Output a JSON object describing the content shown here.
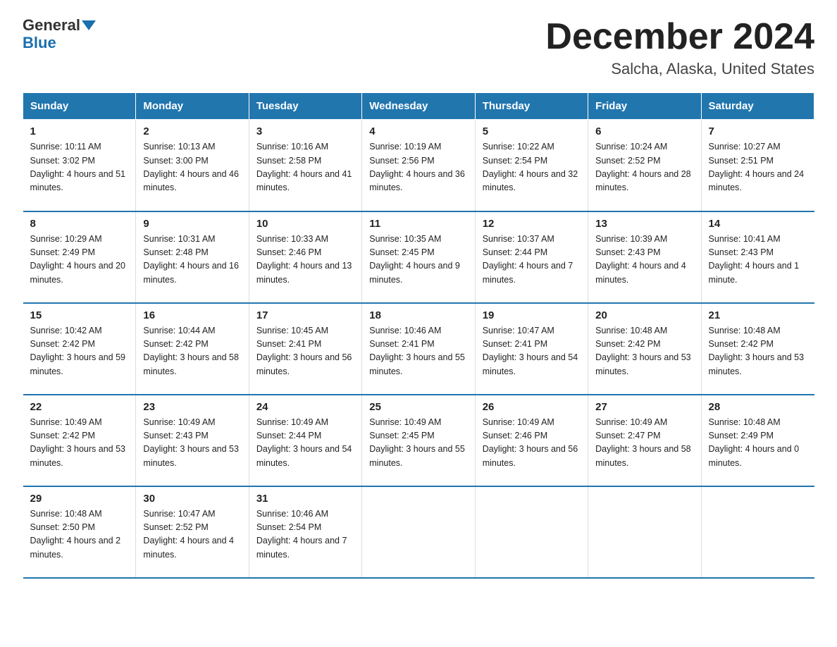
{
  "logo": {
    "general": "General",
    "blue": "Blue"
  },
  "header": {
    "month": "December 2024",
    "location": "Salcha, Alaska, United States"
  },
  "weekdays": [
    "Sunday",
    "Monday",
    "Tuesday",
    "Wednesday",
    "Thursday",
    "Friday",
    "Saturday"
  ],
  "weeks": [
    [
      {
        "day": "1",
        "sunrise": "10:11 AM",
        "sunset": "3:02 PM",
        "daylight": "4 hours and 51 minutes."
      },
      {
        "day": "2",
        "sunrise": "10:13 AM",
        "sunset": "3:00 PM",
        "daylight": "4 hours and 46 minutes."
      },
      {
        "day": "3",
        "sunrise": "10:16 AM",
        "sunset": "2:58 PM",
        "daylight": "4 hours and 41 minutes."
      },
      {
        "day": "4",
        "sunrise": "10:19 AM",
        "sunset": "2:56 PM",
        "daylight": "4 hours and 36 minutes."
      },
      {
        "day": "5",
        "sunrise": "10:22 AM",
        "sunset": "2:54 PM",
        "daylight": "4 hours and 32 minutes."
      },
      {
        "day": "6",
        "sunrise": "10:24 AM",
        "sunset": "2:52 PM",
        "daylight": "4 hours and 28 minutes."
      },
      {
        "day": "7",
        "sunrise": "10:27 AM",
        "sunset": "2:51 PM",
        "daylight": "4 hours and 24 minutes."
      }
    ],
    [
      {
        "day": "8",
        "sunrise": "10:29 AM",
        "sunset": "2:49 PM",
        "daylight": "4 hours and 20 minutes."
      },
      {
        "day": "9",
        "sunrise": "10:31 AM",
        "sunset": "2:48 PM",
        "daylight": "4 hours and 16 minutes."
      },
      {
        "day": "10",
        "sunrise": "10:33 AM",
        "sunset": "2:46 PM",
        "daylight": "4 hours and 13 minutes."
      },
      {
        "day": "11",
        "sunrise": "10:35 AM",
        "sunset": "2:45 PM",
        "daylight": "4 hours and 9 minutes."
      },
      {
        "day": "12",
        "sunrise": "10:37 AM",
        "sunset": "2:44 PM",
        "daylight": "4 hours and 7 minutes."
      },
      {
        "day": "13",
        "sunrise": "10:39 AM",
        "sunset": "2:43 PM",
        "daylight": "4 hours and 4 minutes."
      },
      {
        "day": "14",
        "sunrise": "10:41 AM",
        "sunset": "2:43 PM",
        "daylight": "4 hours and 1 minute."
      }
    ],
    [
      {
        "day": "15",
        "sunrise": "10:42 AM",
        "sunset": "2:42 PM",
        "daylight": "3 hours and 59 minutes."
      },
      {
        "day": "16",
        "sunrise": "10:44 AM",
        "sunset": "2:42 PM",
        "daylight": "3 hours and 58 minutes."
      },
      {
        "day": "17",
        "sunrise": "10:45 AM",
        "sunset": "2:41 PM",
        "daylight": "3 hours and 56 minutes."
      },
      {
        "day": "18",
        "sunrise": "10:46 AM",
        "sunset": "2:41 PM",
        "daylight": "3 hours and 55 minutes."
      },
      {
        "day": "19",
        "sunrise": "10:47 AM",
        "sunset": "2:41 PM",
        "daylight": "3 hours and 54 minutes."
      },
      {
        "day": "20",
        "sunrise": "10:48 AM",
        "sunset": "2:42 PM",
        "daylight": "3 hours and 53 minutes."
      },
      {
        "day": "21",
        "sunrise": "10:48 AM",
        "sunset": "2:42 PM",
        "daylight": "3 hours and 53 minutes."
      }
    ],
    [
      {
        "day": "22",
        "sunrise": "10:49 AM",
        "sunset": "2:42 PM",
        "daylight": "3 hours and 53 minutes."
      },
      {
        "day": "23",
        "sunrise": "10:49 AM",
        "sunset": "2:43 PM",
        "daylight": "3 hours and 53 minutes."
      },
      {
        "day": "24",
        "sunrise": "10:49 AM",
        "sunset": "2:44 PM",
        "daylight": "3 hours and 54 minutes."
      },
      {
        "day": "25",
        "sunrise": "10:49 AM",
        "sunset": "2:45 PM",
        "daylight": "3 hours and 55 minutes."
      },
      {
        "day": "26",
        "sunrise": "10:49 AM",
        "sunset": "2:46 PM",
        "daylight": "3 hours and 56 minutes."
      },
      {
        "day": "27",
        "sunrise": "10:49 AM",
        "sunset": "2:47 PM",
        "daylight": "3 hours and 58 minutes."
      },
      {
        "day": "28",
        "sunrise": "10:48 AM",
        "sunset": "2:49 PM",
        "daylight": "4 hours and 0 minutes."
      }
    ],
    [
      {
        "day": "29",
        "sunrise": "10:48 AM",
        "sunset": "2:50 PM",
        "daylight": "4 hours and 2 minutes."
      },
      {
        "day": "30",
        "sunrise": "10:47 AM",
        "sunset": "2:52 PM",
        "daylight": "4 hours and 4 minutes."
      },
      {
        "day": "31",
        "sunrise": "10:46 AM",
        "sunset": "2:54 PM",
        "daylight": "4 hours and 7 minutes."
      },
      null,
      null,
      null,
      null
    ]
  ]
}
